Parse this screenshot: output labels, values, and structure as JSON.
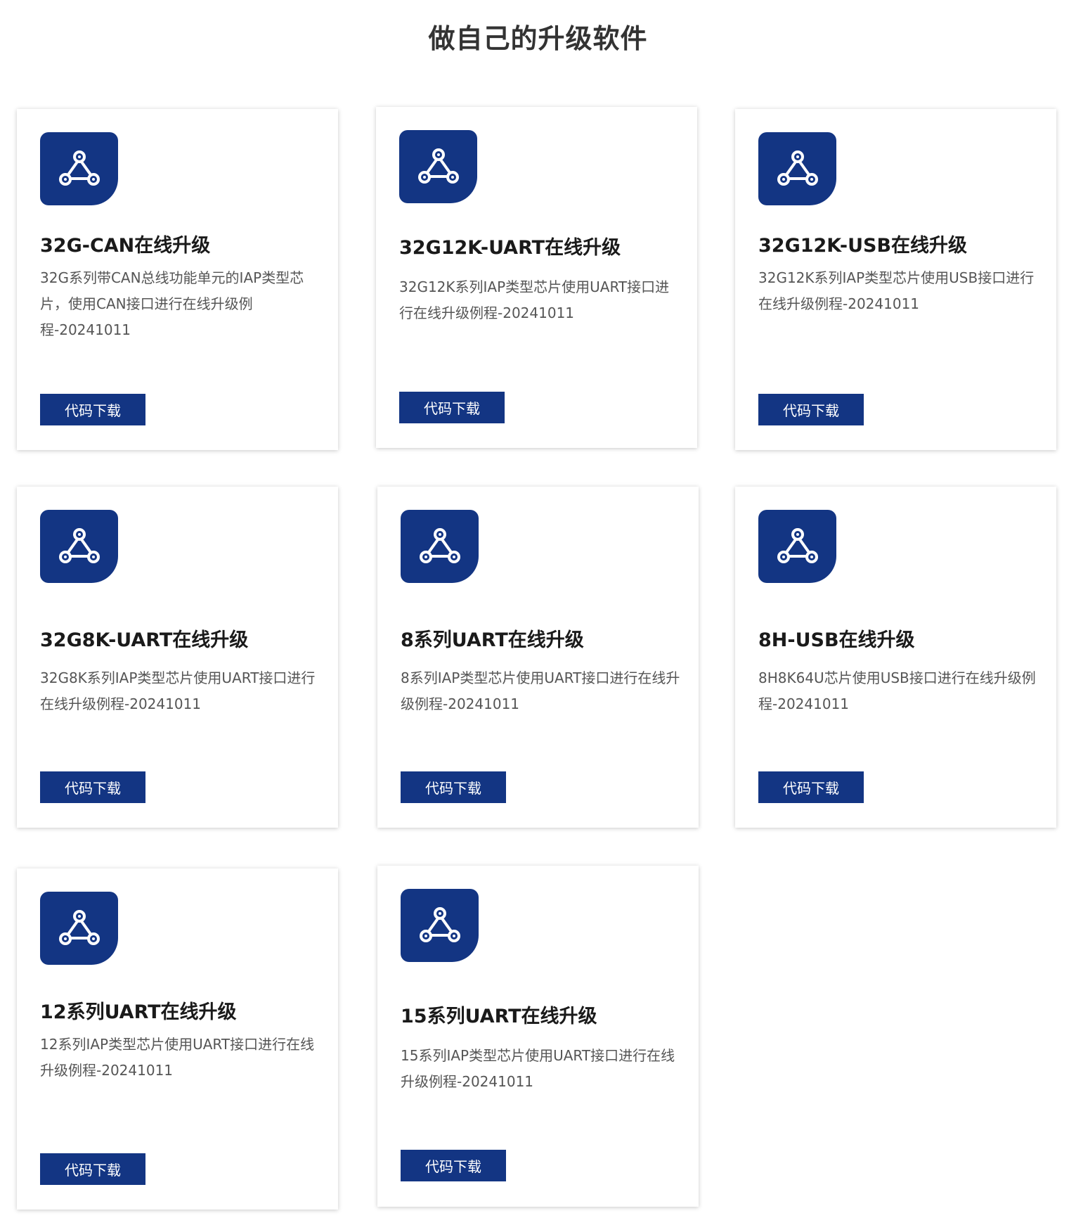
{
  "page": {
    "title": "做自己的升级软件"
  },
  "colors": {
    "accent": "#133583",
    "icon_color": "#ffffff"
  },
  "icon": "share-nodes-icon",
  "cards": [
    {
      "title": "32G-CAN在线升级",
      "desc": "32G系列带CAN总线功能单元的IAP类型芯片，使用CAN接口进行在线升级例程-20241011",
      "button": "代码下载"
    },
    {
      "title": "32G12K-UART在线升级",
      "desc": "32G12K系列IAP类型芯片使用UART接口进行在线升级例程-20241011",
      "button": "代码下载"
    },
    {
      "title": "32G12K-USB在线升级",
      "desc": "32G12K系列IAP类型芯片使用USB接口进行在线升级例程-20241011",
      "button": "代码下载"
    },
    {
      "title": "32G8K-UART在线升级",
      "desc": "32G8K系列IAP类型芯片使用UART接口进行在线升级例程-20241011",
      "button": "代码下载"
    },
    {
      "title": "8系列UART在线升级",
      "desc": "8系列IAP类型芯片使用UART接口进行在线升级例程-20241011",
      "button": "代码下载"
    },
    {
      "title": "8H-USB在线升级",
      "desc": "8H8K64U芯片使用USB接口进行在线升级例程-20241011",
      "button": "代码下载"
    },
    {
      "title": "12系列UART在线升级",
      "desc": "12系列IAP类型芯片使用UART接口进行在线升级例程-20241011",
      "button": "代码下载"
    },
    {
      "title": "15系列UART在线升级",
      "desc": "15系列IAP类型芯片使用UART接口进行在线升级例程-20241011",
      "button": "代码下载"
    }
  ]
}
